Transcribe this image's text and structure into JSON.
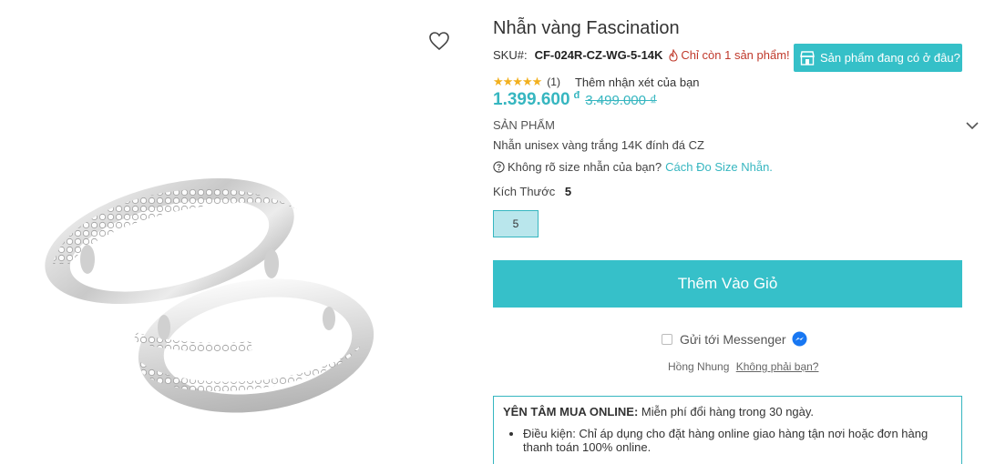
{
  "product": {
    "title": "Nhẫn vàng Fascination",
    "sku_label": "SKU#:",
    "sku": "CF-024R-CZ-WG-5-14K",
    "stock_note": "Chỉ còn 1 sản phẩm!",
    "store_button": "Sản phẩm đang có ở đâu?",
    "rating_stars": "★★★★★",
    "rating_value": 5,
    "rating_count": "(1)",
    "review_link": "Thêm nhận xét của bạn",
    "price": "1.399.600",
    "currency": "đ",
    "old_price": "3.499.000 ₫",
    "section_label": "SẢN PHẨM",
    "description": "Nhẫn unisex vàng trắng 14K đính đá CZ",
    "size_help": "Không rõ size nhẫn của bạn?",
    "size_help_link": "Cách Đo Size Nhẫn.",
    "size_label": "Kích Thước",
    "size_selected": "5",
    "size_options": [
      "5"
    ],
    "add_to_cart": "Thêm Vào Giỏ"
  },
  "messenger": {
    "label": "Gửi tới Messenger",
    "user_name": "Hồng Nhung",
    "not_you": "Không phải bạn?"
  },
  "promo": {
    "heading": "YÊN TÂM MUA ONLINE:",
    "heading_text": "Miễn phí đổi hàng trong 30 ngày.",
    "bullet": "Điều kiện: Chỉ áp dụng cho đặt hàng online giao hàng tận nơi hoặc đơn hàng thanh toán 100% online."
  },
  "icons": {
    "wishlist": "heart-outline-icon",
    "stock": "fire-icon",
    "store": "store-icon",
    "help": "question-circle-icon",
    "expand": "chevron-down-icon",
    "messenger": "messenger-icon"
  },
  "colors": {
    "accent": "#36c0c9",
    "price": "#36b6c0",
    "stock_warning": "#c0392b",
    "stars": "#f2b01e",
    "messenger": "#1877f2"
  }
}
